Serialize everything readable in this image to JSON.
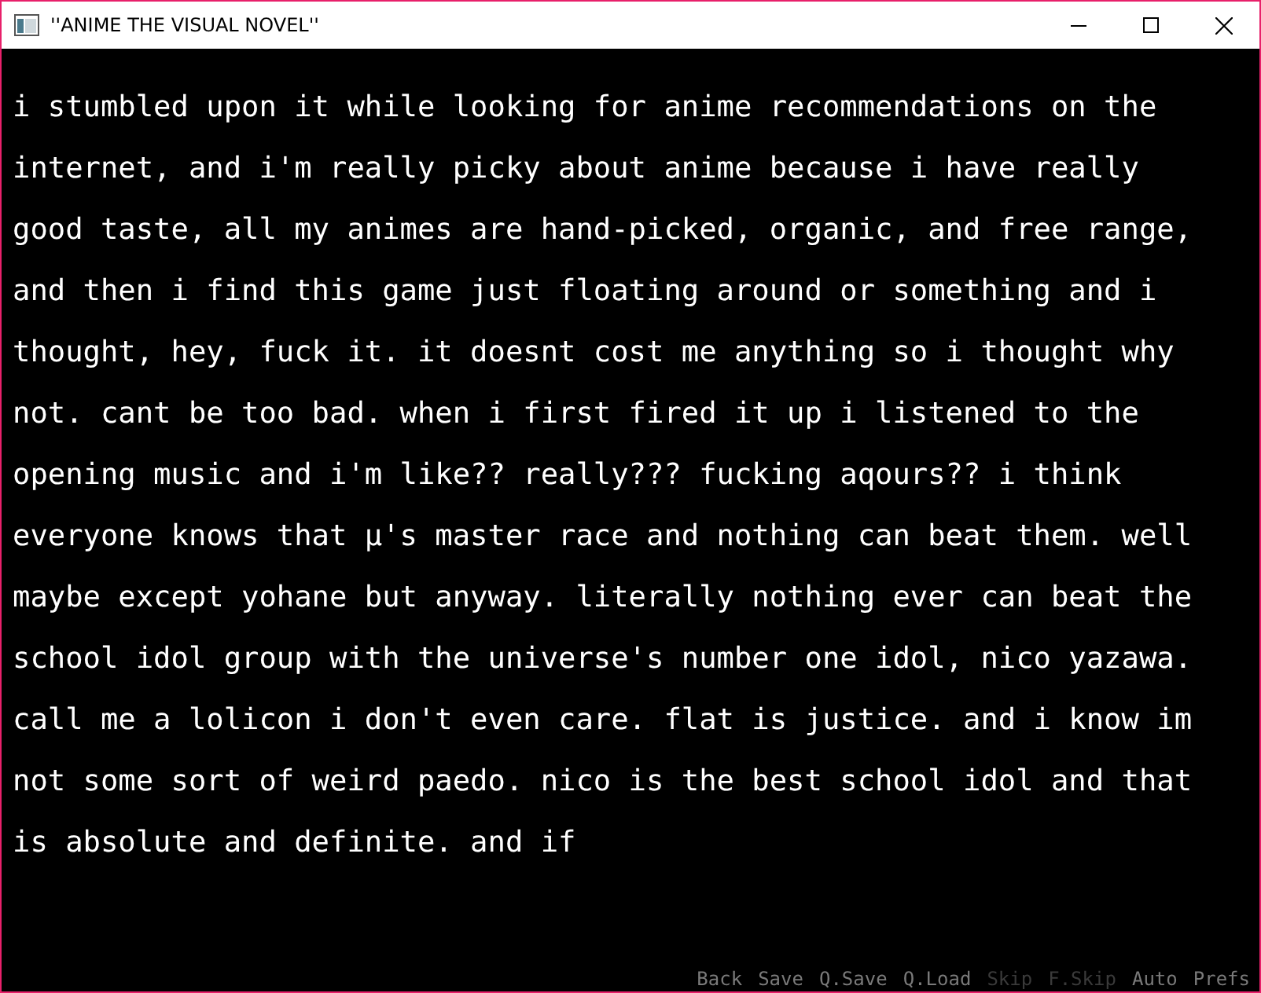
{
  "window": {
    "title": "''ANIME THE VISUAL NOVEL''"
  },
  "dialogue": {
    "lines": [
      "i stumbled upon it while looking for anime recommendations on the",
      "internet, and i'm really picky about anime because i have really",
      "good taste, all my animes are hand-picked, organic, and free range,",
      "and then i find this game just floating around or something and i",
      "thought, hey, fuck it. it doesnt cost me anything so i thought why",
      "not. cant be too bad. when i first fired it up i listened to the",
      "opening music and i'm like?? really??? fucking aqours?? i think",
      "everyone knows that μ's master race and nothing can beat them. well",
      "maybe except yohane but anyway. literally nothing ever can beat the",
      "school idol group with the universe's number one idol, nico yazawa.",
      "call me a lolicon i don't even care. flat is justice. and i know im",
      "not some sort of weird paedo. nico is the best school idol and that",
      "is absolute and definite. and if"
    ]
  },
  "quick_menu": [
    {
      "label": "Back",
      "disabled": false
    },
    {
      "label": "Save",
      "disabled": false
    },
    {
      "label": "Q.Save",
      "disabled": false
    },
    {
      "label": "Q.Load",
      "disabled": false
    },
    {
      "label": "Skip",
      "disabled": true
    },
    {
      "label": "F.Skip",
      "disabled": true
    },
    {
      "label": "Auto",
      "disabled": false
    },
    {
      "label": "Prefs",
      "disabled": false
    }
  ]
}
